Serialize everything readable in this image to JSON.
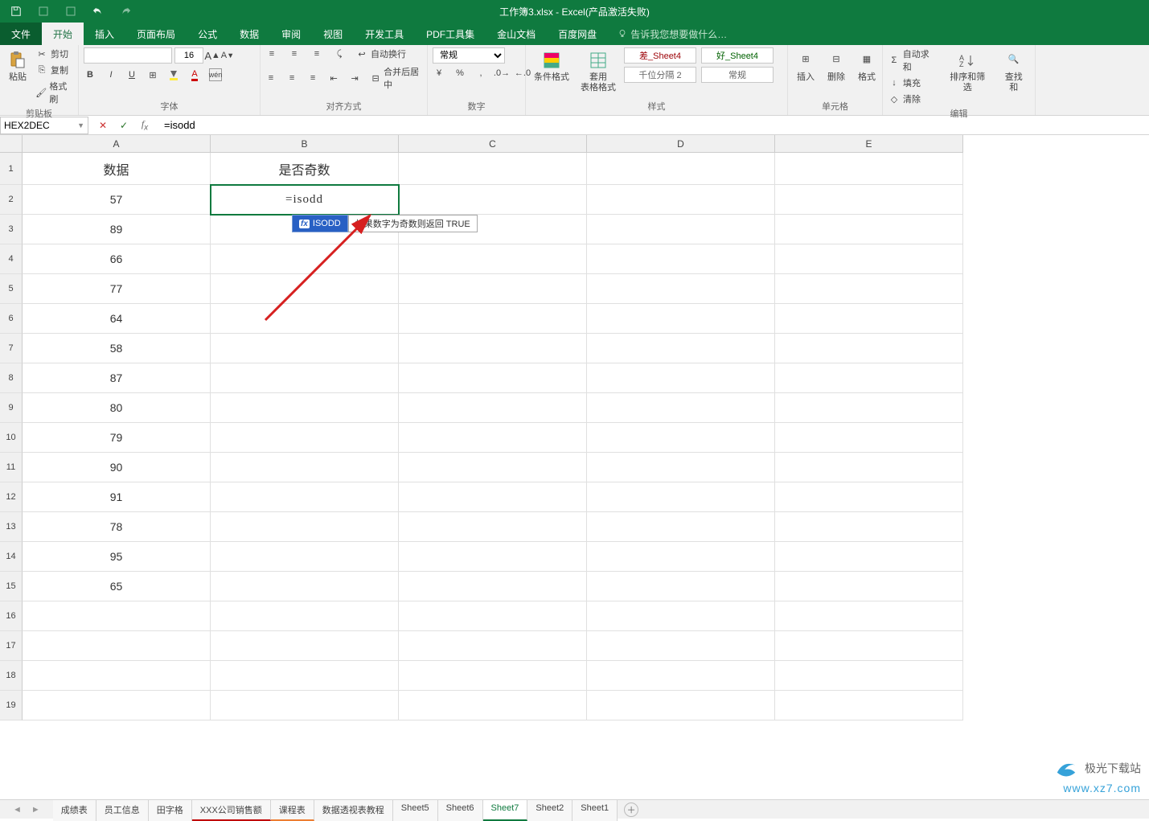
{
  "titlebar": {
    "title": "工作簿3.xlsx - Excel(产品激活失败)"
  },
  "tabs": {
    "file": "文件",
    "home": "开始",
    "insert": "插入",
    "layout": "页面布局",
    "formulas": "公式",
    "data": "数据",
    "review": "审阅",
    "view": "视图",
    "dev": "开发工具",
    "pdf": "PDF工具集",
    "kingsoft": "金山文档",
    "baidu": "百度网盘",
    "tellme": "告诉我您想要做什么…"
  },
  "ribbon": {
    "clipboard": {
      "paste": "粘贴",
      "cut": "剪切",
      "copy": "复制",
      "brush": "格式刷",
      "group": "剪贴板"
    },
    "font": {
      "size": "16",
      "incr": "A",
      "decr": "A",
      "group": "字体"
    },
    "align": {
      "wrap": "自动换行",
      "merge": "合并后居中",
      "group": "对齐方式"
    },
    "number": {
      "format": "常规",
      "group": "数字"
    },
    "styles": {
      "cond": "条件格式",
      "table": "套用\n表格格式",
      "bad": "差_Sheet4",
      "good": "好_Sheet4",
      "thousand": "千位分隔 2",
      "normal": "常规",
      "group": "样式"
    },
    "cells": {
      "insert": "插入",
      "delete": "删除",
      "format": "格式",
      "group": "单元格"
    },
    "editing": {
      "sum": "自动求和",
      "fill": "填充",
      "clear": "清除",
      "sort": "排序和筛选",
      "find": "查找和",
      "group": "编辑"
    }
  },
  "namebox": "HEX2DEC",
  "formula": "=isodd",
  "grid": {
    "cols": [
      "A",
      "B",
      "C",
      "D",
      "E"
    ],
    "header": {
      "A": "数据",
      "B": "是否奇数"
    },
    "data_A": [
      "57",
      "89",
      "66",
      "77",
      "64",
      "58",
      "87",
      "80",
      "79",
      "90",
      "91",
      "78",
      "95",
      "65"
    ],
    "B2": "=isodd",
    "row_count": 19,
    "row_hdr_h": 40,
    "row_data_h": 37
  },
  "func_popup": {
    "name": "ISODD",
    "desc": "如果数字为奇数则返回 TRUE"
  },
  "sheets": [
    "成绩表",
    "员工信息",
    "田字格",
    "XXX公司销售额",
    "课程表",
    "数据透视表教程",
    "Sheet5",
    "Sheet6",
    "Sheet7",
    "Sheet2",
    "Sheet1"
  ],
  "active_sheet": "Sheet7",
  "watermark": {
    "brand": "极光下载站",
    "url": "www.xz7.com"
  }
}
